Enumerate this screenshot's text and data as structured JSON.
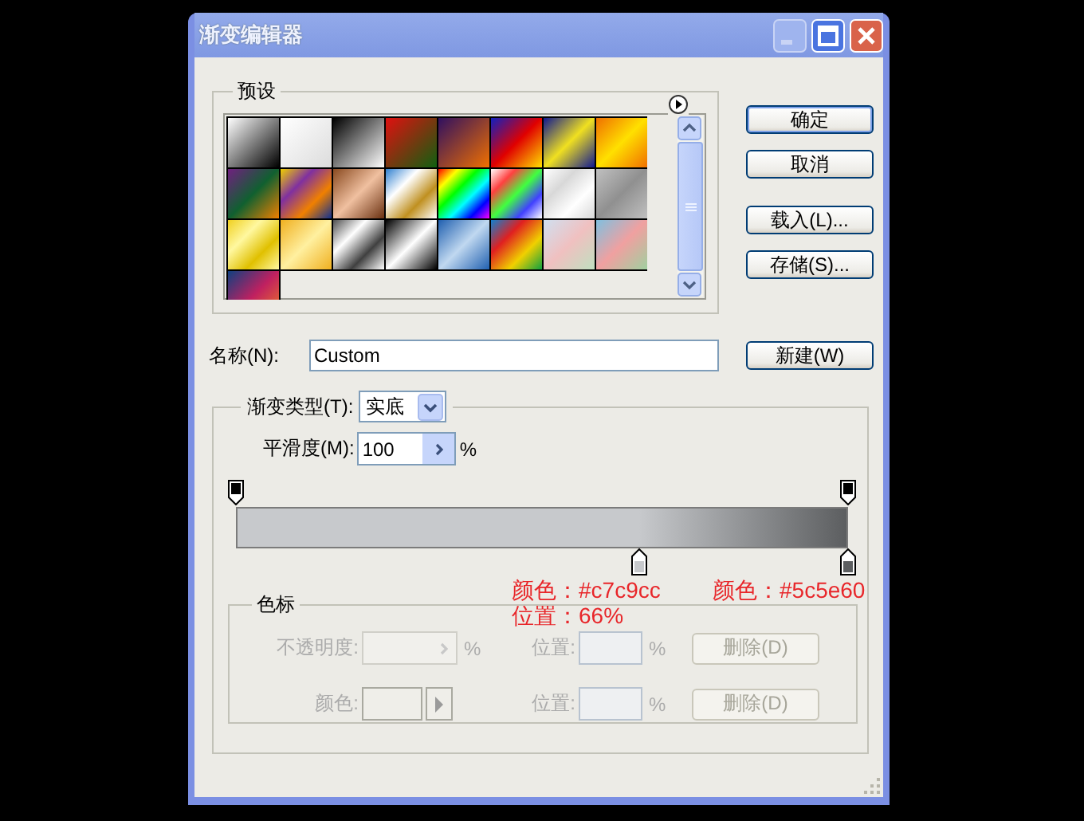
{
  "window": {
    "title": "渐变编辑器"
  },
  "presets": {
    "label": "预设"
  },
  "buttons": [
    {
      "label": "确定",
      "default": true
    },
    {
      "label": "取消",
      "default": false
    },
    {
      "label": "载入(L)...",
      "default": false
    },
    {
      "label": "存储(S)...",
      "default": false
    }
  ],
  "name_field": {
    "label": "名称(N):",
    "value": "Custom"
  },
  "new_button": {
    "label": "新建(W)"
  },
  "gradient": {
    "type_label": "渐变类型(T):",
    "type_value": "实底",
    "smoothness_label": "平滑度(M):",
    "smoothness_value": "100",
    "smoothness_unit": "%",
    "opacity_stops": [
      {
        "level": 0
      },
      {
        "level": 1
      }
    ],
    "color_stops": [
      {
        "level": 0.66,
        "color": "#c7c9cc"
      },
      {
        "level": 1,
        "color": "#5c5e60"
      }
    ],
    "annotations": [
      {
        "text": "颜色：#c7c9cc"
      },
      {
        "text": "位置：66%"
      },
      {
        "text": "颜色：#5c5e60"
      }
    ]
  },
  "stops_group": {
    "label": "色标",
    "rows": [
      {
        "kind": "opacity",
        "label": "不透明度:",
        "unit": "%",
        "position_label": "位置:",
        "position_unit": "%",
        "delete_label": "删除(D)",
        "disabled": true
      },
      {
        "kind": "color",
        "label": "颜色:",
        "position_label": "位置:",
        "position_unit": "%",
        "delete_label": "删除(D)",
        "disabled": true
      }
    ]
  }
}
